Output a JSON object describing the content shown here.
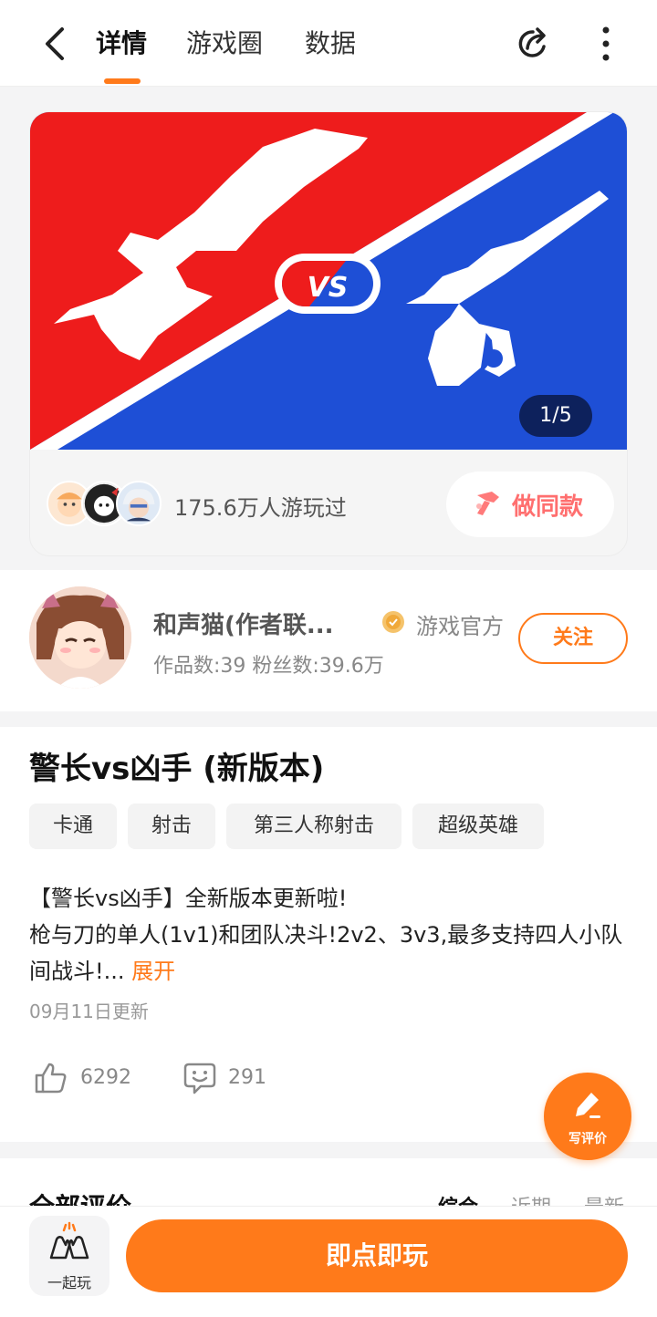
{
  "header": {
    "tabs": [
      {
        "label": "详情"
      },
      {
        "label": "游戏圈"
      },
      {
        "label": "数据"
      }
    ]
  },
  "banner": {
    "page_indicator": "1/5",
    "vs_text": "VS",
    "colors": {
      "red": "#ee1c1c",
      "blue": "#1e4fd6"
    },
    "plays_text": "175.6万人游玩过",
    "same_button_label": "做同款"
  },
  "author": {
    "name": "和声猫(作者联...",
    "badge": "游戏官方",
    "stats": "作品数:39 粉丝数:39.6万",
    "follow_label": "关注"
  },
  "game": {
    "title": "警长vs凶手 (新版本)",
    "tags": [
      "卡通",
      "射击",
      "第三人称射击",
      "超级英雄"
    ],
    "description_line1": "【警长vs凶手】全新版本更新啦!",
    "description_line2": "枪与刀的单人(1v1)和团队决斗!2v2、3v3,最多支持四人小队间战斗!...",
    "expand_label": "展开",
    "update_text": "09月11日更新",
    "likes": "6292",
    "comments": "291"
  },
  "write_review_label": "写评价",
  "reviews": {
    "title": "全部评价",
    "sorts": [
      "综合",
      "近期",
      "最新"
    ]
  },
  "bottom": {
    "together_label": "一起玩",
    "play_label": "即点即玩"
  },
  "accent_color": "#ff7a1a"
}
